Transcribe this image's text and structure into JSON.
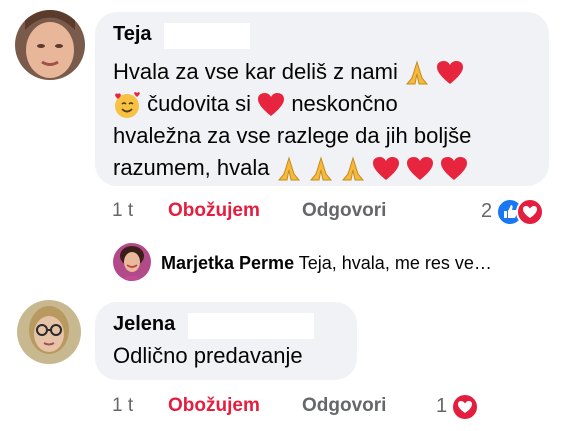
{
  "comments": [
    {
      "author": "Teja",
      "lines": [
        {
          "before": "Hvala za vse kar deliš z nami ",
          "emojis": [
            "pray",
            "heart"
          ],
          "after": ""
        },
        {
          "before": "",
          "emojis": [
            "smiling-hearts"
          ],
          "after": " čudovita si ",
          "emojis2": [
            "heart"
          ],
          "after2": " neskončno"
        },
        {
          "before": "hvaležna za vse razlege da jih boljše"
        },
        {
          "before": "razumem, hvala ",
          "emojis": [
            "pray",
            "pray",
            "pray",
            "heart",
            "heart",
            "heart"
          ],
          "after": ""
        }
      ],
      "time": "1 t",
      "like_label": "Obožujem",
      "reply_label": "Odgovori",
      "reaction_count": "2",
      "reactions": [
        "like",
        "love"
      ]
    },
    {
      "author": "Jelena",
      "text": "Odlično predavanje",
      "time": "1 t",
      "like_label": "Obožujem",
      "reply_label": "Odgovori",
      "reaction_count": "1",
      "reactions": [
        "love"
      ]
    }
  ],
  "reply_preview": {
    "author": "Marjetka Perme",
    "text": "Teja, hvala, me res ve…"
  },
  "colors": {
    "bubble": "#f0f2f5",
    "love": "#e41e3f",
    "like": "#1877f2",
    "muted": "#65676b"
  }
}
